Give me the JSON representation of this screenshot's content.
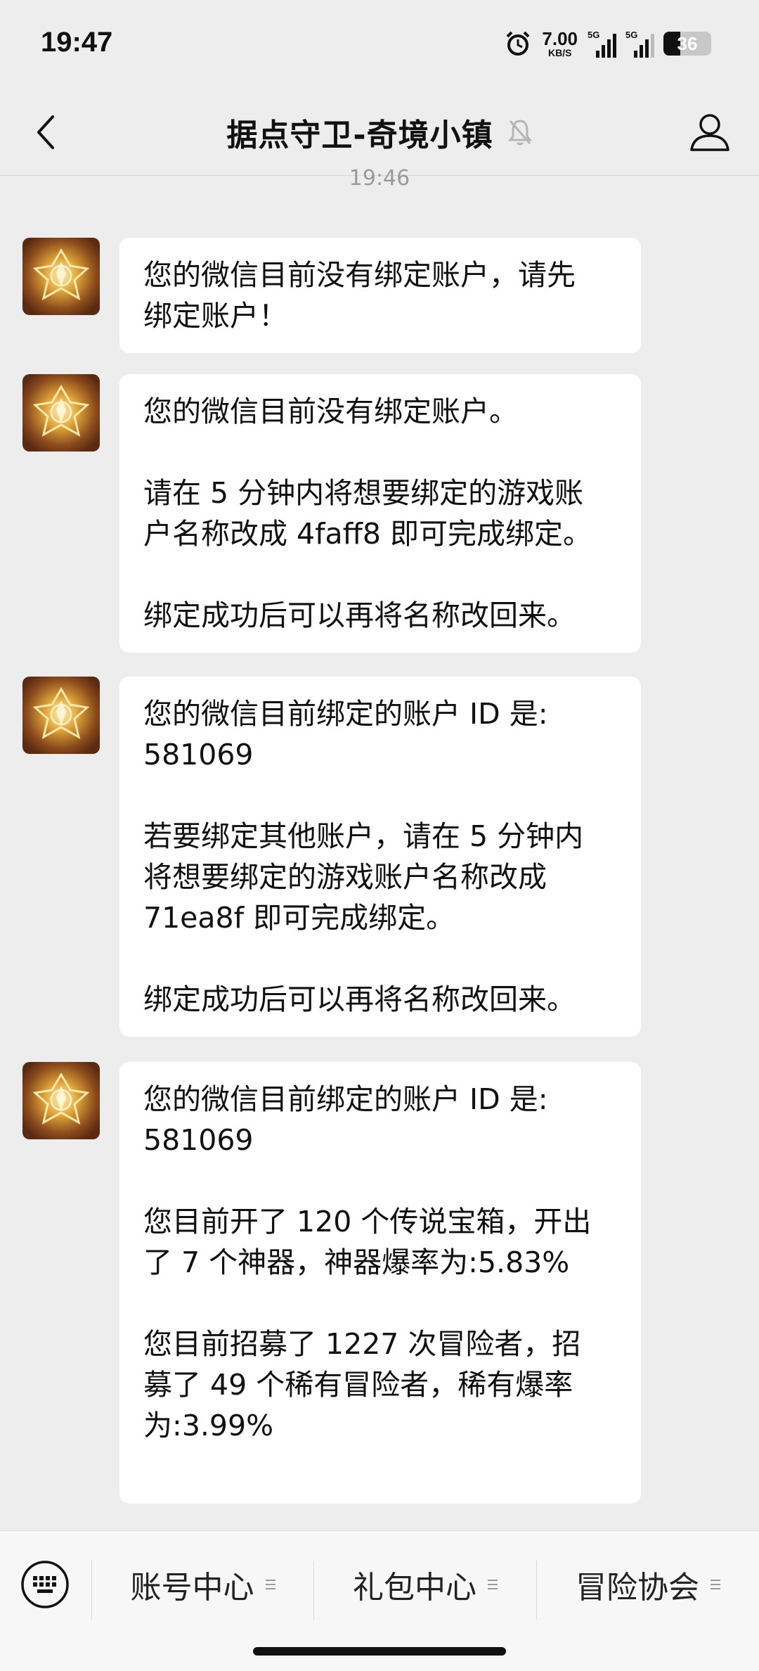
{
  "status_bar": {
    "time": "19:47",
    "net_speed_value": "7.00",
    "net_speed_unit": "KB/S",
    "sim1_label": "5G",
    "sim2_label": "5G",
    "battery": "36",
    "battery_level": 0.36
  },
  "header": {
    "title": "据点守卫-奇境小镇",
    "icons": [
      "back-icon",
      "mute-bell-icon",
      "profile-icon"
    ]
  },
  "chat": {
    "timestamp": "19:46",
    "messages": [
      {
        "lines": [
          "您的微信目前没有绑定账户，请先",
          "绑定账户！"
        ]
      },
      {
        "lines": [
          "您的微信目前没有绑定账户。",
          "",
          "请在 5 分钟内将想要绑定的游戏账",
          "户名称改成 4faff8 即可完成绑定。",
          "",
          "绑定成功后可以再将名称改回来。"
        ]
      },
      {
        "lines": [
          "您的微信目前绑定的账户 ID 是:",
          "581069",
          "",
          "若要绑定其他账户，请在 5 分钟内",
          "将想要绑定的游戏账户名称改成",
          "71ea8f 即可完成绑定。",
          "",
          "绑定成功后可以再将名称改回来。"
        ]
      },
      {
        "lines": [
          "您的微信目前绑定的账户 ID 是:",
          "581069",
          "",
          "您目前开了 120 个传说宝箱，开出",
          "了 7 个神器，神器爆率为:5.83%",
          "",
          "您目前招募了 1227 次冒险者，招",
          "募了 49 个稀有冒险者，稀有爆率",
          "为:3.99%",
          ""
        ]
      }
    ]
  },
  "bottom_menu": {
    "keyboard_icon": "keyboard-icon",
    "items": [
      "账号中心",
      "礼包中心",
      "冒险协会"
    ]
  },
  "colors": {
    "background": "#ededed",
    "bubble": "#ffffff",
    "avatar_gold": "#e0a53a",
    "avatar_dark": "#5a2a12"
  }
}
